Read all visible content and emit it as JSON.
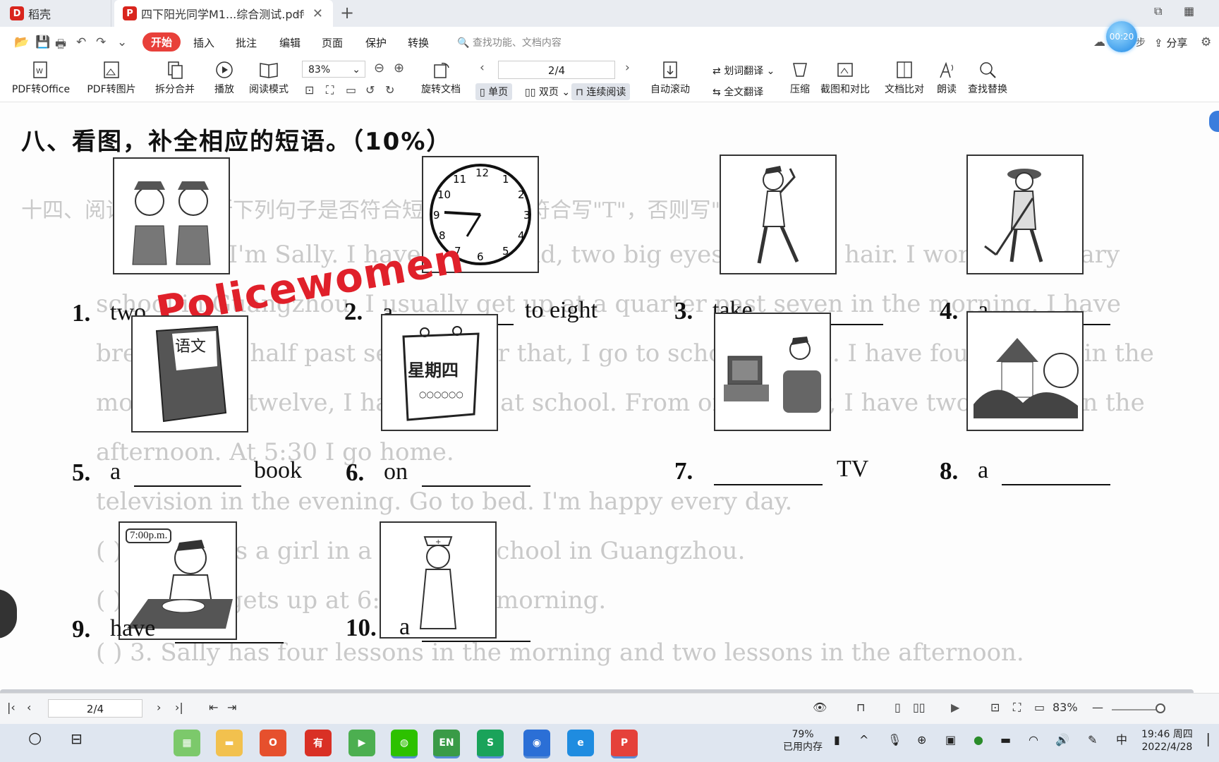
{
  "tabs": {
    "home": "稻壳",
    "doc": "四下阳光同学M1...综合测试.pdf"
  },
  "menu": {
    "items": [
      "开始",
      "插入",
      "批注",
      "编辑",
      "页面",
      "保护",
      "转换"
    ],
    "search_placeholder": "查找功能、文档内容",
    "timer": "00:20",
    "sync_suffix": "步",
    "share": "分享"
  },
  "toolbar": {
    "pdf_to_office": "PDF转Office",
    "pdf_to_image": "PDF转图片",
    "split_merge": "拆分合并",
    "play": "播放",
    "read_mode": "阅读模式",
    "zoom": "83%",
    "rotate": "旋转文档",
    "page": "2/4",
    "single": "单页",
    "double": "双页",
    "continuous": "连续阅读",
    "auto_scroll": "自动滚动",
    "word_translate": "划词翻译",
    "full_translate": "全文翻译",
    "compress": "压缩",
    "screenshot_compare": "截图和对比",
    "doc_compare": "文档比对",
    "read_aloud": "朗读",
    "find_replace": "查找替换"
  },
  "document": {
    "heading": "八、看图，补全相应的短语。（10%）",
    "questions": [
      {
        "num": "1.",
        "pre": "two",
        "post": ""
      },
      {
        "num": "2.",
        "pre": "a",
        "post": "to eight"
      },
      {
        "num": "3.",
        "pre": "take",
        "post": ""
      },
      {
        "num": "4.",
        "pre": "a",
        "post": ""
      },
      {
        "num": "5.",
        "pre": "a",
        "post": "book"
      },
      {
        "num": "6.",
        "pre": "on",
        "post": ""
      },
      {
        "num": "7.",
        "pre": "",
        "post": "TV"
      },
      {
        "num": "8.",
        "pre": "a",
        "post": ""
      },
      {
        "num": "9.",
        "pre": "have",
        "post": ""
      },
      {
        "num": "10.",
        "pre": "a",
        "post": ""
      }
    ],
    "handwritten": "Policewomen",
    "pic_labels": {
      "book": "语文",
      "calendar": "星期四",
      "time": "7:00p.m."
    },
    "ghost_lines": [
      "十四、阅读短文，判断下列句子是否符合短文内容，若符合写\"T\"，否则写\"F\"。(5%)",
      "Hello, I'm Sally. I have a big head, two big eyes and long hair. I work in Primary",
      "school in Guangzhou. I usually get up at a quarter past seven in the morning. I have",
      "breakfast at half past seven. After that, I go to school by bus. I have four lessons in the",
      "morning. At twelve, I have lunch at school. From one to four, I have two lessons in the",
      "afternoon. At 5:30 I go home.",
      "television in the evening. Go to bed. I'm happy every day.",
      "(  ) 1. Sally is a girl in a primary school in Guangzhou.",
      "(  ) 2. Sally gets up at 6:45 in the morning.",
      "(  ) 3. Sally has four lessons in the morning and two lessons in the afternoon."
    ]
  },
  "statusbar": {
    "page": "2/4",
    "zoom": "83%"
  },
  "taskbar": {
    "memory_pct": "79%",
    "memory_label": "已用内存",
    "ime": "中",
    "time": "19:46 周四",
    "date": "2022/4/28"
  }
}
